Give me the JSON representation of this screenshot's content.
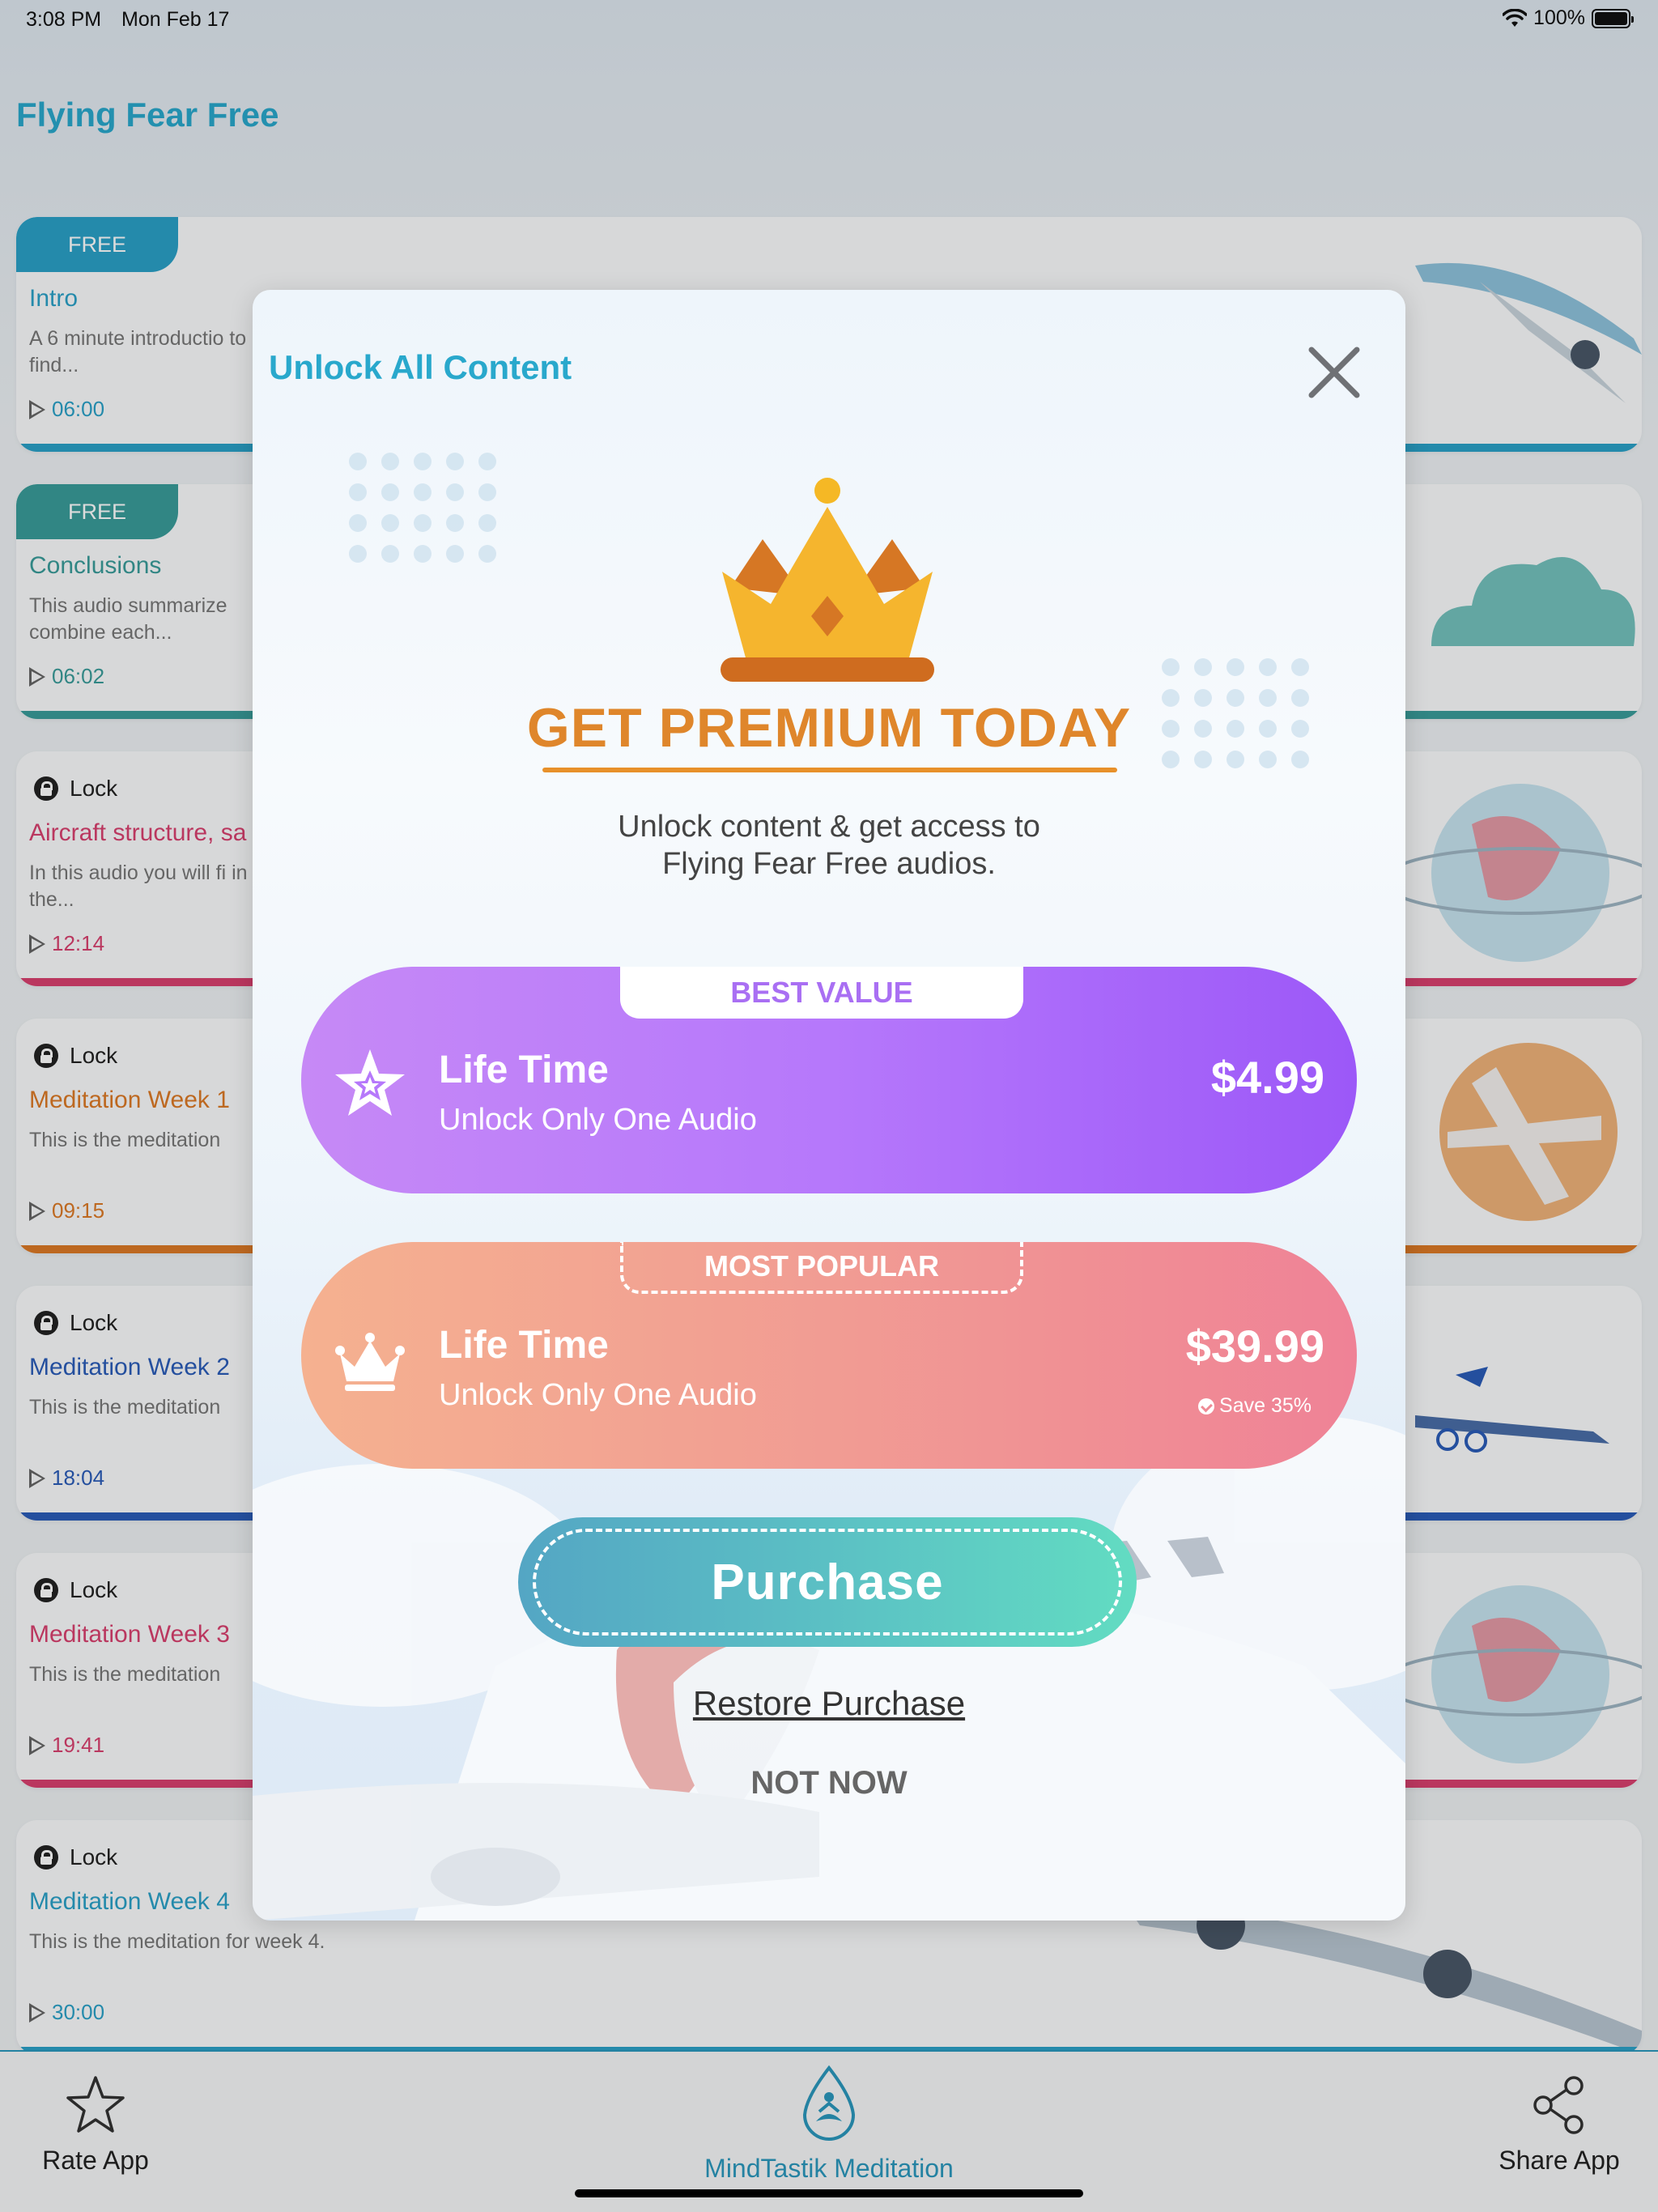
{
  "status_bar": {
    "time": "3:08 PM",
    "date": "Mon Feb 17",
    "battery": "100%"
  },
  "app": {
    "title": "Flying Fear Free"
  },
  "cards": [
    {
      "badge": "FREE",
      "title": "Intro",
      "desc": "A 6 minute introductio to find...",
      "duration": "06:00",
      "color": "#2aa1c8"
    },
    {
      "badge": "FREE",
      "title": "Conclusions",
      "desc": "This audio summarize combine each...",
      "duration": "06:02",
      "color": "#3a9c9a"
    },
    {
      "badge": "Lock",
      "title": "Aircraft structure, sa",
      "desc": "In this audio you will fi in the...",
      "duration": "12:14",
      "color": "#d9416f"
    },
    {
      "badge": "Lock",
      "title": "Meditation Week 1",
      "desc": "This is the meditation",
      "duration": "09:15",
      "color": "#dc7a26"
    },
    {
      "badge": "Lock",
      "title": "Meditation Week 2",
      "desc": "This is the meditation",
      "duration": "18:04",
      "color": "#2b5cb8"
    },
    {
      "badge": "Lock",
      "title": "Meditation Week 3",
      "desc": "This is the meditation",
      "duration": "19:41",
      "color": "#d9416f"
    },
    {
      "badge": "Lock",
      "title": "Meditation Week 4",
      "desc": "This is the meditation for week 4.",
      "duration": "30:00",
      "color": "#2aa1c8"
    }
  ],
  "tabbar": {
    "rate": "Rate App",
    "home": "MindTastik Meditation",
    "share": "Share App"
  },
  "modal": {
    "title": "Unlock All Content",
    "headline": "GET PREMIUM TODAY",
    "subtitle_line1": "Unlock content & get access to",
    "subtitle_line2": "Flying Fear Free audios.",
    "plans": [
      {
        "tag": "BEST VALUE",
        "name": "Life Time",
        "desc": "Unlock Only One Audio",
        "price": "$4.99",
        "icon": "star-icon"
      },
      {
        "tag": "MOST POPULAR",
        "name": "Life Time",
        "desc": "Unlock Only One Audio",
        "price": "$39.99",
        "save": "Save 35%",
        "icon": "crown-icon"
      }
    ],
    "purchase": "Purchase",
    "restore": "Restore Purchase",
    "not_now": "NOT NOW"
  },
  "colors": {
    "accent": "#29a8cc",
    "premium": "#df862b",
    "plan1": "#b678fb",
    "plan2": "#f19c93",
    "purchase": "#5bc0c4"
  }
}
